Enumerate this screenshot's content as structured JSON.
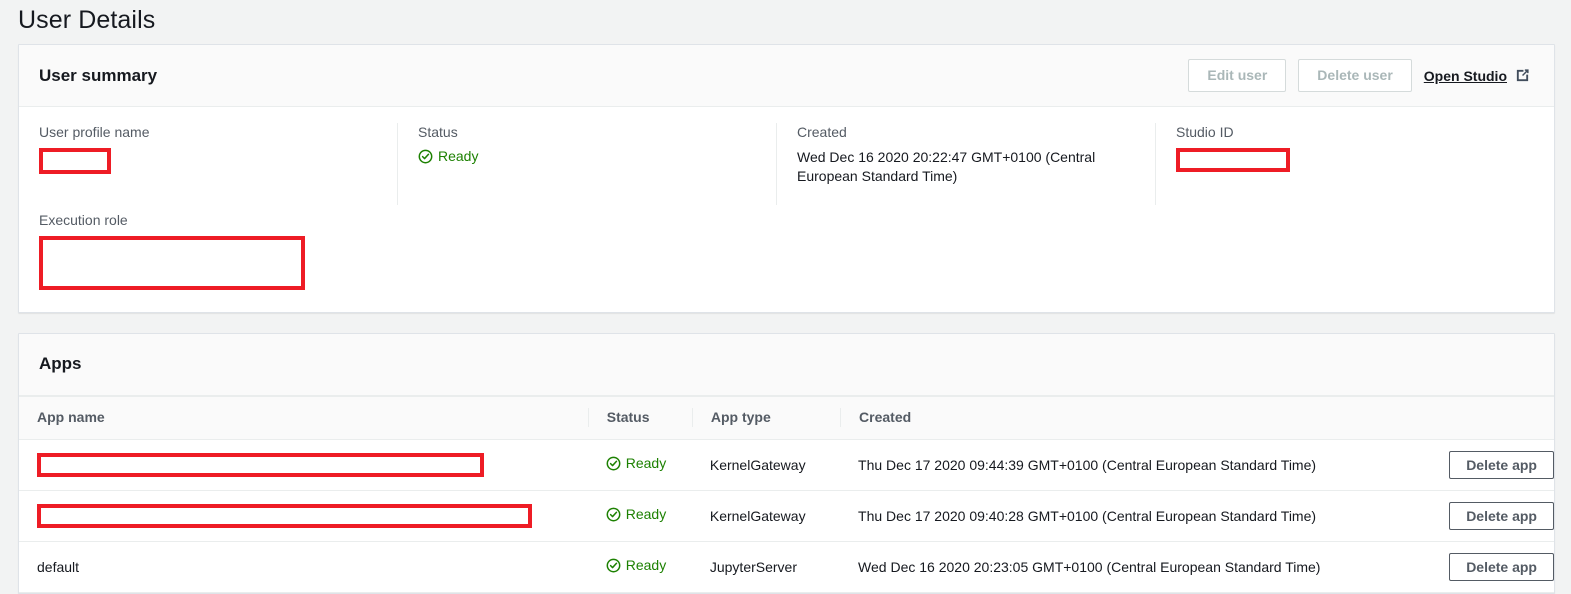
{
  "page": {
    "title": "User Details"
  },
  "user_summary": {
    "title": "User summary",
    "actions": {
      "edit_user": "Edit user",
      "delete_user": "Delete user",
      "open_studio": "Open Studio",
      "open_studio_icon": "external-link-icon"
    },
    "fields": {
      "user_profile_name": {
        "label": "User profile name",
        "value": "",
        "redacted": true
      },
      "status": {
        "label": "Status",
        "value": "Ready",
        "icon": "status-ready-check-icon",
        "color": "#1d8102"
      },
      "created": {
        "label": "Created",
        "value": "Wed Dec 16 2020 20:22:47 GMT+0100 (Central European Standard Time)"
      },
      "studio_id": {
        "label": "Studio ID",
        "value": "",
        "redacted": true
      },
      "execution_role": {
        "label": "Execution role",
        "value": "",
        "redacted": true
      }
    }
  },
  "apps": {
    "title": "Apps",
    "columns": {
      "app_name": "App name",
      "status": "Status",
      "app_type": "App type",
      "created": "Created",
      "actions": ""
    },
    "delete_button_label": "Delete app",
    "rows": [
      {
        "app_name": "",
        "app_name_redacted": true,
        "status": "Ready",
        "status_icon": "status-ready-check-icon",
        "app_type": "KernelGateway",
        "created": "Thu Dec 17 2020 09:44:39 GMT+0100 (Central European Standard Time)",
        "action": "Delete app"
      },
      {
        "app_name": "",
        "app_name_redacted": true,
        "status": "Ready",
        "status_icon": "status-ready-check-icon",
        "app_type": "KernelGateway",
        "created": "Thu Dec 17 2020 09:40:28 GMT+0100 (Central European Standard Time)",
        "action": "Delete app"
      },
      {
        "app_name": "default",
        "app_name_redacted": false,
        "status": "Ready",
        "status_icon": "status-ready-check-icon",
        "app_type": "JupyterServer",
        "created": "Wed Dec 16 2020 20:23:05 GMT+0100 (Central European Standard Time)",
        "action": "Delete app"
      }
    ]
  },
  "colors": {
    "page_background": "#f2f3f3",
    "card_background": "#ffffff",
    "card_header_background": "#fafafa",
    "border": "#eaeded",
    "label_text": "#545b64",
    "body_text": "#16191f",
    "status_green": "#1d8102",
    "redaction_red": "#ee1c25",
    "disabled_text": "#aab7b8"
  }
}
